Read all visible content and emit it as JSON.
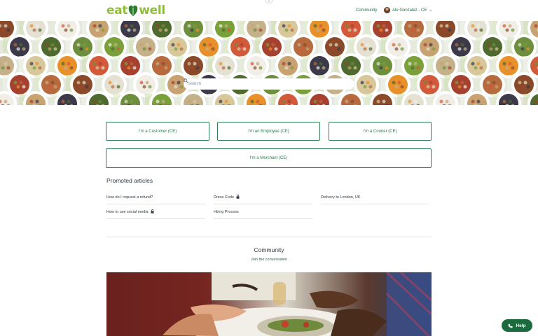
{
  "header": {
    "logo_text_left": "eat",
    "logo_text_right": "well",
    "nav_community": "Community",
    "user_name": "Ale Gonzalez - CE",
    "user_chevron": "⌄"
  },
  "search": {
    "placeholder": "Search"
  },
  "roles": [
    {
      "label": "I'm a Customer (CE)"
    },
    {
      "label": "I'm an Employee (CE)"
    },
    {
      "label": "I'm a Courier (CE)"
    },
    {
      "label": "I'm a Merchant (CE)"
    }
  ],
  "promoted": {
    "title": "Promoted articles",
    "articles": [
      {
        "title": "How do I request a refund?",
        "locked": false
      },
      {
        "title": "Dress Code",
        "locked": true
      },
      {
        "title": "Delivery to London, UK",
        "locked": false
      },
      {
        "title": "How to use social media",
        "locked": true
      },
      {
        "title": "Hiring Process",
        "locked": false
      }
    ]
  },
  "community": {
    "title": "Community",
    "link": "Join the conversation"
  },
  "help": {
    "label": "Help"
  },
  "colors": {
    "brand_green": "#8fbc3b",
    "accent_green": "#2e7d55",
    "help_green": "#1c6b3f"
  },
  "icons": [
    "leaf-icon",
    "search-icon",
    "lock-icon",
    "phone-icon",
    "chevron-down-icon"
  ]
}
